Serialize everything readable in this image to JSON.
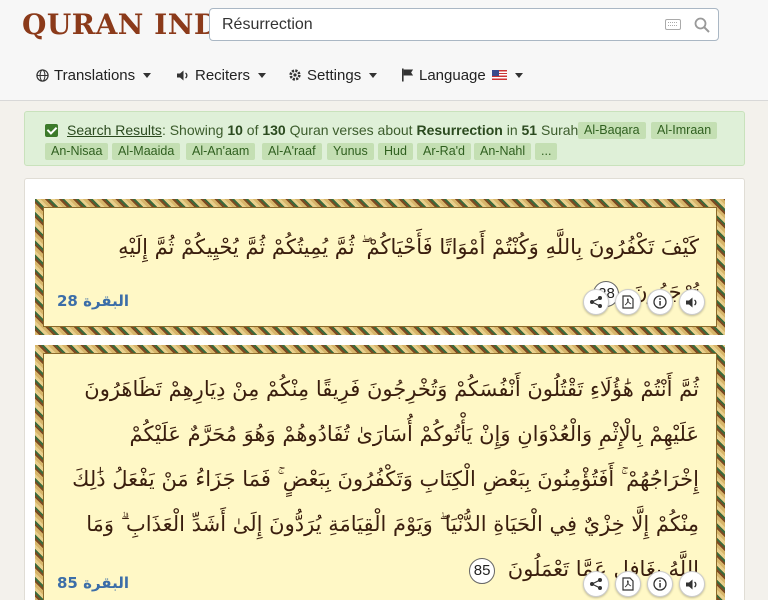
{
  "header": {
    "logo_text": "QURAN INDEX",
    "search_value": "Résurrection",
    "nav": {
      "translations": "Translations",
      "reciters": "Reciters",
      "settings": "Settings",
      "language": "Language"
    }
  },
  "results": {
    "link_text": "Search Results",
    "showing_prefix": ": Showing ",
    "shown_count": "10",
    "of_text": " of ",
    "total_count": "130",
    "about_text": " Quran verses about ",
    "query": "Resurrection",
    "in_text": " in ",
    "surah_count": "51",
    "surahs_text": " Surahs",
    "tags": [
      "Al-Baqara",
      "Al-Imraan",
      "An-Nisaa",
      "Al-Maaida",
      "Al-An'aam",
      "Al-A'raaf",
      "Yunus",
      "Hud",
      "Ar-Ra'd",
      "An-Nahl",
      "..."
    ]
  },
  "verses": [
    {
      "text": "كَيْفَ تَكْفُرُونَ بِاللَّهِ وَكُنْتُمْ أَمْوَاتًا فَأَحْيَاكُمْ ۖ ثُمَّ يُمِيتُكُمْ ثُمَّ يُحْيِيكُمْ ثُمَّ إِلَيْهِ تُرْجَعُونَ",
      "number": "28",
      "surah": "البقرة",
      "ref_number": "28"
    },
    {
      "text": "ثُمَّ أَنْتُمْ هَٰؤُلَاءِ تَقْتُلُونَ أَنْفُسَكُمْ وَتُخْرِجُونَ فَرِيقًا مِنْكُمْ مِنْ دِيَارِهِمْ تَظَاهَرُونَ عَلَيْهِمْ بِالْإِثْمِ وَالْعُدْوَانِ وَإِنْ يَأْتُوكُمْ أُسَارَىٰ تُفَادُوهُمْ وَهُوَ مُحَرَّمٌ عَلَيْكُمْ إِخْرَاجُهُمْ ۚ أَفَتُؤْمِنُونَ بِبَعْضِ الْكِتَابِ وَتَكْفُرُونَ بِبَعْضٍ ۚ فَمَا جَزَاءُ مَنْ يَفْعَلُ ذَٰلِكَ مِنْكُمْ إِلَّا خِزْيٌ فِي الْحَيَاةِ الدُّنْيَا ۖ وَيَوْمَ الْقِيَامَةِ يُرَدُّونَ إِلَىٰ أَشَدِّ الْعَذَابِ ۗ وَمَا اللَّهُ بِغَافِلٍ عَمَّا تَعْمَلُونَ",
      "number": "85",
      "surah": "البقرة",
      "ref_number": "85"
    }
  ],
  "icons": [
    "search-icon",
    "keyboard-icon",
    "globe-icon",
    "speaker-icon",
    "gear-icon",
    "flag-icon",
    "share-icon",
    "pdf-icon",
    "info-icon",
    "audio-icon"
  ],
  "colors": {
    "logo": "#8b3a1a",
    "banner_bg": "#dff0d8",
    "verse_bg": "#fff8c6",
    "surah_ref": "#3c6ea8"
  }
}
